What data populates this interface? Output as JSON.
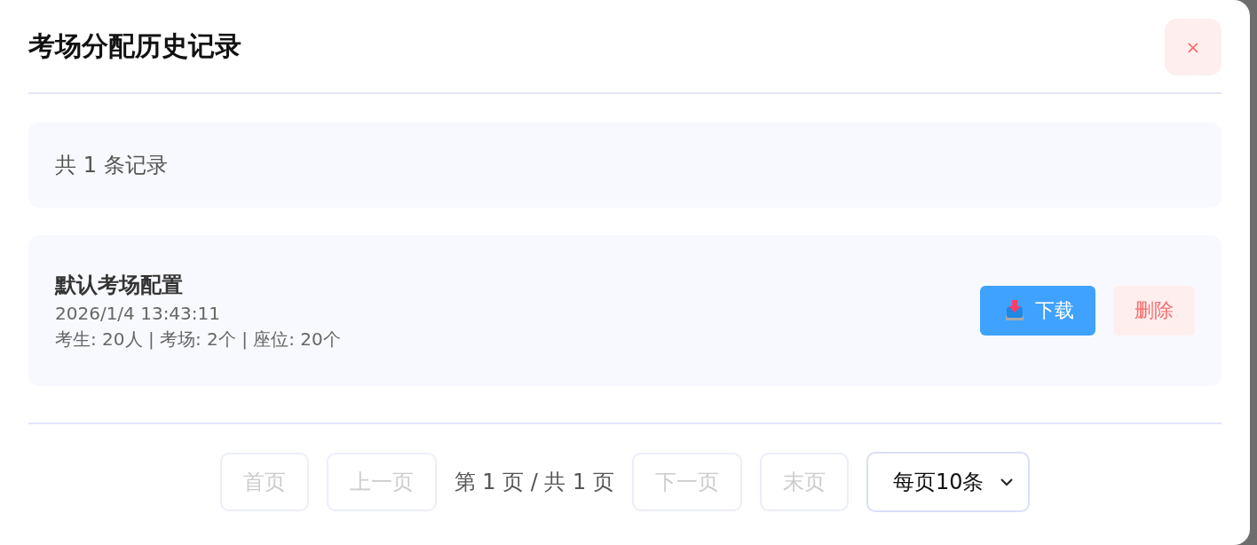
{
  "dialog": {
    "title": "考场分配历史记录",
    "close_label": "×"
  },
  "summary": "共 1 条记录",
  "records": [
    {
      "name": "默认考场配置",
      "time": "2026/1/4 13:43:11",
      "stats": "考生: 20人 | 考场: 2个 | 座位: 20个",
      "actions": [
        {
          "kind": "download",
          "label": "下载"
        },
        {
          "kind": "delete",
          "label": "删除"
        }
      ]
    }
  ],
  "pagination": {
    "buttons_before": [
      {
        "label": "首页",
        "disabled": true
      },
      {
        "label": "上一页",
        "disabled": true
      }
    ],
    "page_info": "第 1 页 / 共 1 页",
    "buttons_after": [
      {
        "label": "下一页",
        "disabled": true
      },
      {
        "label": "末页",
        "disabled": true
      }
    ],
    "page_size": "每页10条"
  }
}
